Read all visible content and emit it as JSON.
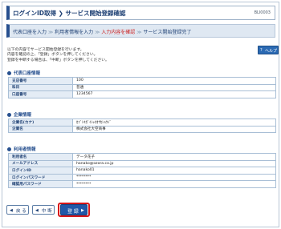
{
  "header": {
    "title": "ログインID取得 ❯ サービス開始登録確認",
    "screen_code": "BLI0003"
  },
  "steps": {
    "items": [
      "代表口座を入力",
      "利用者情報を入力",
      "入力内容を確認",
      "サービス開始登録完了"
    ],
    "separator": "≫",
    "current_index": 2
  },
  "intro": {
    "lines": [
      "以下の内容でサービス開始登録を行います。",
      "内容を確認の上、「登録」ボタンを押してください。",
      "登録を中断する場合は、「中断」ボタンを押してください。"
    ]
  },
  "help": {
    "label": "ヘルプ",
    "icon": "?"
  },
  "sections": [
    {
      "title": "代表口座情報",
      "rows": [
        {
          "label": "支店番号",
          "value": "100"
        },
        {
          "label": "科目",
          "value": "普通"
        },
        {
          "label": "口座番号",
          "value": "1234567"
        }
      ]
    },
    {
      "title": "企業情報",
      "rows": [
        {
          "label": "企業名(カナ)",
          "value": "ｶﾌﾞｼｷｶﾞｲｼｬｵｵｻｶｼｮｳｼﾞ"
        },
        {
          "label": "企業名",
          "value": "株式会社大空商事"
        }
      ]
    },
    {
      "title": "利用者情報",
      "rows": [
        {
          "label": "利用者名",
          "value": "データ花子"
        },
        {
          "label": "メールアドレス",
          "value": "hanako@ozora.co.jp"
        },
        {
          "label": "ログインID",
          "value": "hanako01"
        },
        {
          "label": "ログインパスワード",
          "value": "********"
        },
        {
          "label": "確認用パスワード",
          "value": "********"
        }
      ]
    }
  ],
  "buttons": {
    "back": {
      "label": "戻 る",
      "icon": "◀"
    },
    "cancel": {
      "label": "中 断",
      "icon": "◀"
    },
    "register": {
      "label": "登 録",
      "icon": "▶"
    }
  },
  "colors": {
    "accent": "#27508f",
    "highlight": "#d6171a",
    "primary_button": "#2157a8",
    "current_step": "#cc1f1f"
  }
}
